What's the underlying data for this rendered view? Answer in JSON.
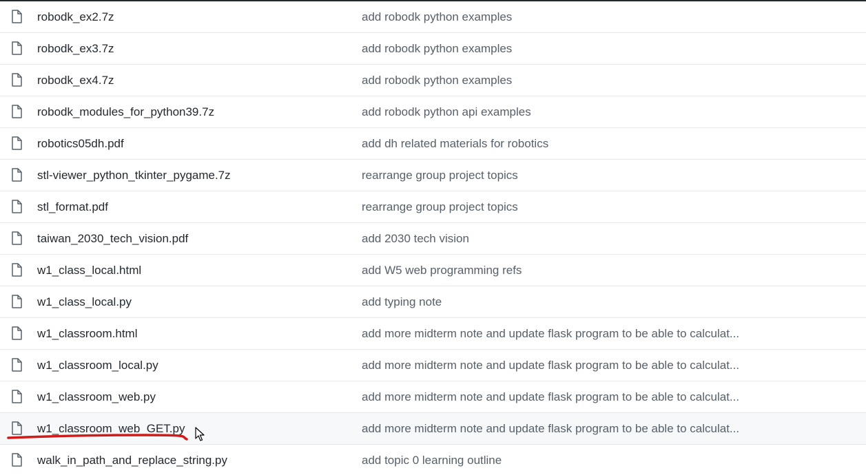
{
  "files": [
    {
      "name": "robodk_ex2.7z",
      "message": "add robodk python examples",
      "icon": "file-icon"
    },
    {
      "name": "robodk_ex3.7z",
      "message": "add robodk python examples",
      "icon": "file-icon"
    },
    {
      "name": "robodk_ex4.7z",
      "message": "add robodk python examples",
      "icon": "file-icon"
    },
    {
      "name": "robodk_modules_for_python39.7z",
      "message": "add robodk python api examples",
      "icon": "file-icon"
    },
    {
      "name": "robotics05dh.pdf",
      "message": "add dh related materials for robotics",
      "icon": "file-icon"
    },
    {
      "name": "stl-viewer_python_tkinter_pygame.7z",
      "message": "rearrange group project topics",
      "icon": "file-icon"
    },
    {
      "name": "stl_format.pdf",
      "message": "rearrange group project topics",
      "icon": "file-icon"
    },
    {
      "name": "taiwan_2030_tech_vision.pdf",
      "message": "add 2030 tech vision",
      "icon": "file-icon"
    },
    {
      "name": "w1_class_local.html",
      "message": "add W5 web programming refs",
      "icon": "file-icon"
    },
    {
      "name": "w1_class_local.py",
      "message": "add typing note",
      "icon": "file-icon"
    },
    {
      "name": "w1_classroom.html",
      "message": "add more midterm note and update flask program to be able to calculat...",
      "icon": "file-icon"
    },
    {
      "name": "w1_classroom_local.py",
      "message": "add more midterm note and update flask program to be able to calculat...",
      "icon": "file-icon"
    },
    {
      "name": "w1_classroom_web.py",
      "message": "add more midterm note and update flask program to be able to calculat...",
      "icon": "file-icon"
    },
    {
      "name": "w1_classroom_web_GET.py",
      "message": "add more midterm note and update flask program to be able to calculat...",
      "icon": "file-icon",
      "hovered": true
    },
    {
      "name": "walk_in_path_and_replace_string.py",
      "message": "add topic 0 learning outline",
      "icon": "file-icon"
    }
  ],
  "colors": {
    "file_name": "#24292f",
    "commit_message": "#57606a",
    "row_border": "#e6e8eb",
    "hover_background": "#f6f8fa",
    "icon": "#57606a",
    "annotation_underline": "#d11a1a"
  },
  "annotation": {
    "type": "hand-drawn-underline",
    "target": "w1_classroom_web_GET.py"
  },
  "cursor": {
    "type": "arrow-pointer",
    "target": "w1_classroom_web_GET.py"
  }
}
